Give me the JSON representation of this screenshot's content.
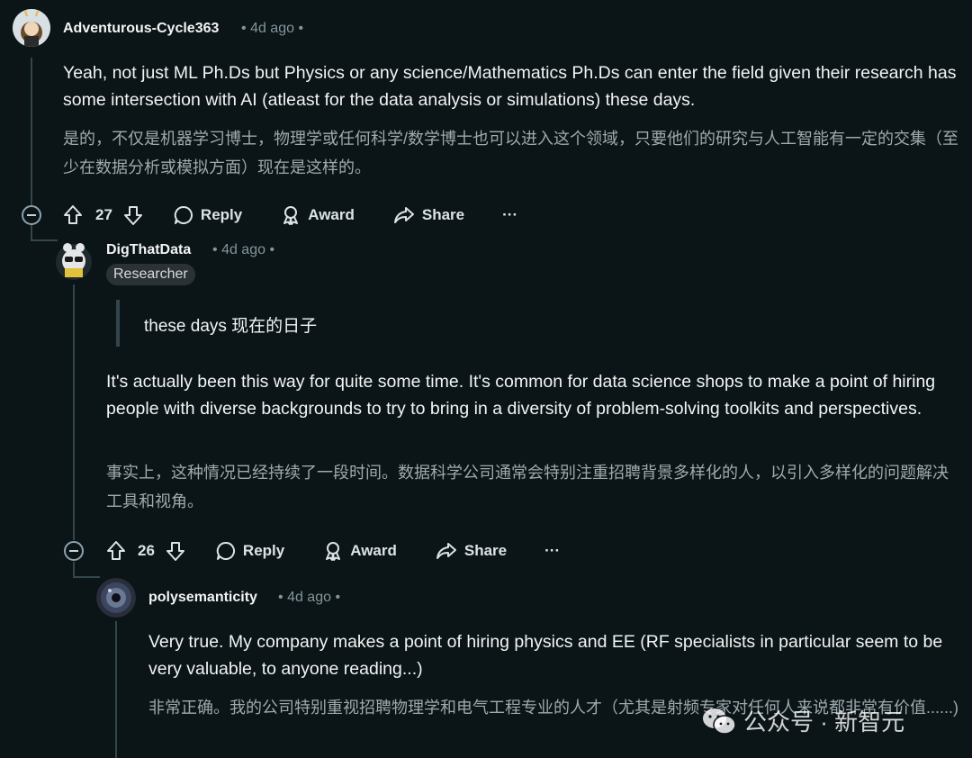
{
  "comments": [
    {
      "username": "Adventurous-Cycle363",
      "time": "4d ago",
      "sep_before": "•",
      "sep_after": "•",
      "body_en": "Yeah, not just ML Ph.Ds but Physics or any science/Mathematics Ph.Ds can enter the field given their research has some intersection with AI (atleast for the data analysis or simulations) these days.",
      "body_zh": "是的，不仅是机器学习博士，物理学或任何科学/数学博士也可以进入这个领域，只要他们的研究与人工智能有一定的交集（至少在数据分析或模拟方面）现在是这样的。",
      "votes": "27"
    },
    {
      "username": "DigThatData",
      "time": "4d ago",
      "sep_before": "•",
      "sep_after": "•",
      "flair": "Researcher",
      "quote": "these days  现在的日子",
      "body_en": "It's actually been this way for quite some time. It's common for data science shops to make a point of hiring people with diverse backgrounds to try to bring in a diversity of problem-solving toolkits and perspectives.",
      "body_zh": "事实上，这种情况已经持续了一段时间。数据科学公司通常会特别注重招聘背景多样化的人，以引入多样化的问题解决工具和视角。",
      "votes": "26"
    },
    {
      "username": "polysemanticity",
      "time": "4d ago",
      "sep_before": "•",
      "sep_after": "•",
      "body_en": "Very true. My company makes a point of hiring physics and EE (RF specialists in particular seem to be very valuable, to anyone reading...)",
      "body_zh": "非常正确。我的公司特别重视招聘物理学和电气工程专业的人才（尤其是射频专家对任何人来说都非常有价值......)"
    }
  ],
  "actions": {
    "reply": "Reply",
    "award": "Award",
    "share": "Share",
    "more": "···"
  },
  "watermark": "公众号 · 新智元",
  "icons": {
    "upvote": "arrow-up-outline-icon",
    "downvote": "arrow-down-outline-icon",
    "reply": "speech-bubble-icon",
    "award": "award-ribbon-icon",
    "share": "share-arrow-icon",
    "collapse": "minus-circle-icon",
    "watermark": "wechat-icon"
  },
  "colors": {
    "background": "#0b1416",
    "text": "#f2f4f5",
    "muted": "#82959b",
    "thread_line": "#33464c"
  }
}
